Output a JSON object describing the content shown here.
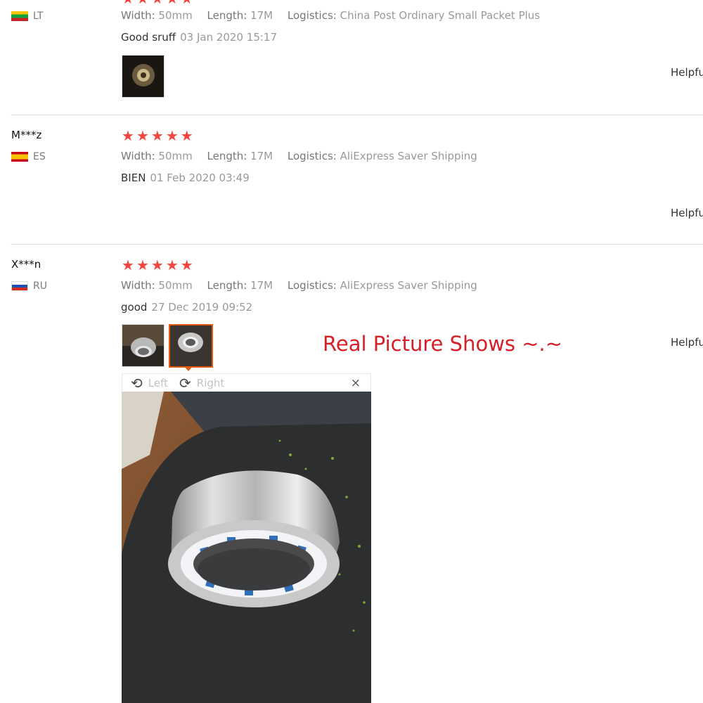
{
  "reviews": [
    {
      "country_code": "LT",
      "rating": 5,
      "attrs": {
        "width_label": "Width:",
        "width_value": "50mm",
        "length_label": "Length:",
        "length_value": "17M",
        "logistics_label": "Logistics:",
        "logistics_value": "China Post Ordinary Small Packet Plus"
      },
      "comment": "Good sruff",
      "time": "03 Jan 2020 15:17",
      "helpful": "Helpful"
    },
    {
      "user": "M***z",
      "country_code": "ES",
      "rating": 5,
      "attrs": {
        "width_label": "Width:",
        "width_value": "50mm",
        "length_label": "Length:",
        "length_value": "17M",
        "logistics_label": "Logistics:",
        "logistics_value": "AliExpress Saver Shipping"
      },
      "comment": "BIEN",
      "time": "01 Feb 2020 03:49",
      "helpful": "Helpful"
    },
    {
      "user": "X***n",
      "country_code": "RU",
      "rating": 5,
      "attrs": {
        "width_label": "Width:",
        "width_value": "50mm",
        "length_label": "Length:",
        "length_value": "17M",
        "logistics_label": "Logistics:",
        "logistics_value": "AliExpress Saver Shipping"
      },
      "comment": "good",
      "time": "27 Dec 2019 09:52",
      "helpful": "Helpful"
    }
  ],
  "viewer": {
    "rotate_left_label": "Left",
    "rotate_right_label": "Right",
    "close_symbol": "×"
  },
  "overlay_text": "Real Picture Shows ~.~",
  "icons": {
    "star": "star-icon",
    "rotate_left": "rotate-left-icon",
    "rotate_right": "rotate-right-icon",
    "close": "close-icon"
  },
  "colors": {
    "star": "#f1453d",
    "overlay_text": "#d62027",
    "active_thumb_border": "#e8590c"
  }
}
